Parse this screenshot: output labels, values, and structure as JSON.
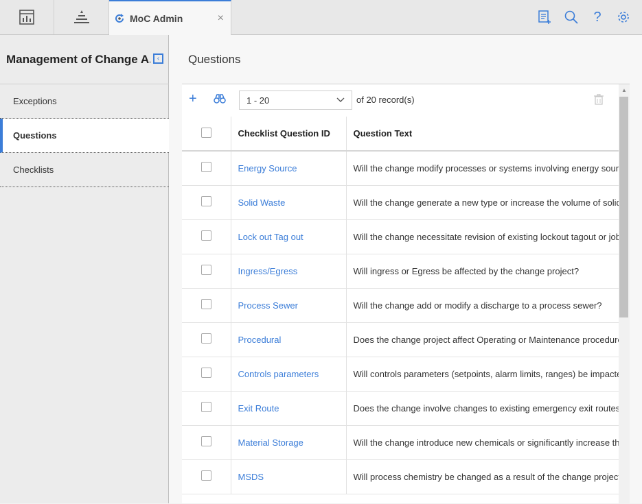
{
  "topbar": {
    "icons": [
      "dashboard-icon",
      "hierarchy-icon"
    ],
    "active_tab": {
      "label": "MoC Admin",
      "icon": "refresh-icon",
      "close": "×"
    },
    "right_icons": [
      "notes-add-icon",
      "search-icon",
      "help-icon",
      "gear-icon"
    ],
    "help_glyph": "?"
  },
  "sidebar": {
    "title": "Management of Change A...",
    "collapse_glyph": "‹",
    "items": [
      {
        "label": "Exceptions",
        "active": false
      },
      {
        "label": "Questions",
        "active": true
      },
      {
        "label": "Checklists",
        "active": false
      }
    ]
  },
  "main": {
    "title": "Questions",
    "toolbar": {
      "add_glyph": "+",
      "pager_value": "1 - 20",
      "record_info": "of  20  record(s)"
    },
    "table": {
      "columns": [
        "",
        "Checklist Question ID",
        "Question Text"
      ],
      "rows": [
        {
          "id": "Energy Source",
          "text": "Will the change modify processes or systems involving energy sources ("
        },
        {
          "id": "Solid Waste",
          "text": "Will the change generate a new type or increase the volume of solid wa"
        },
        {
          "id": "Lock out Tag out",
          "text": "Will the change necessitate revision of existing lockout tagout or job sa"
        },
        {
          "id": "Ingress/Egress",
          "text": "Will ingress or Egress be affected by the change project?"
        },
        {
          "id": "Process Sewer",
          "text": "Will the change add or modify a discharge to a process sewer?"
        },
        {
          "id": "Procedural",
          "text": "Does the change project affect Operating or Maintenance procedures?"
        },
        {
          "id": "Controls parameters",
          "text": "Will controls parameters (setpoints, alarm limits, ranges) be impacted b"
        },
        {
          "id": "Exit Route",
          "text": "Does the change involve changes to existing emergency exit routes, mu"
        },
        {
          "id": "Material Storage",
          "text": "Will the change introduce new chemicals or significantly increase the us"
        },
        {
          "id": "MSDS",
          "text": "Will process chemistry be changed as a result of the change project?"
        }
      ]
    }
  },
  "colors": {
    "accent": "#3b7dd8",
    "link": "#3b7dd8"
  }
}
